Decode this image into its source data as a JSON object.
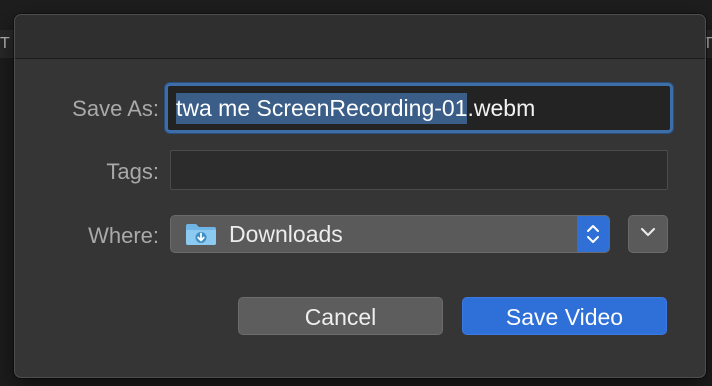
{
  "background": {
    "left_glyph": "T",
    "right_glyph": "T"
  },
  "dialog": {
    "save_as_label": "Save As:",
    "filename_selected": "twa me ScreenRecording-01",
    "filename_extension": ".webm",
    "tags_label": "Tags:",
    "tags_value": "",
    "where_label": "Where:",
    "where_value": "Downloads",
    "where_icon": "downloads-folder-icon",
    "cancel_label": "Cancel",
    "save_label": "Save Video"
  },
  "colors": {
    "accent": "#2e6fd8",
    "selection": "#3b5e88",
    "focus_ring": "#3d6ea8",
    "sheet_bg": "#353535"
  }
}
